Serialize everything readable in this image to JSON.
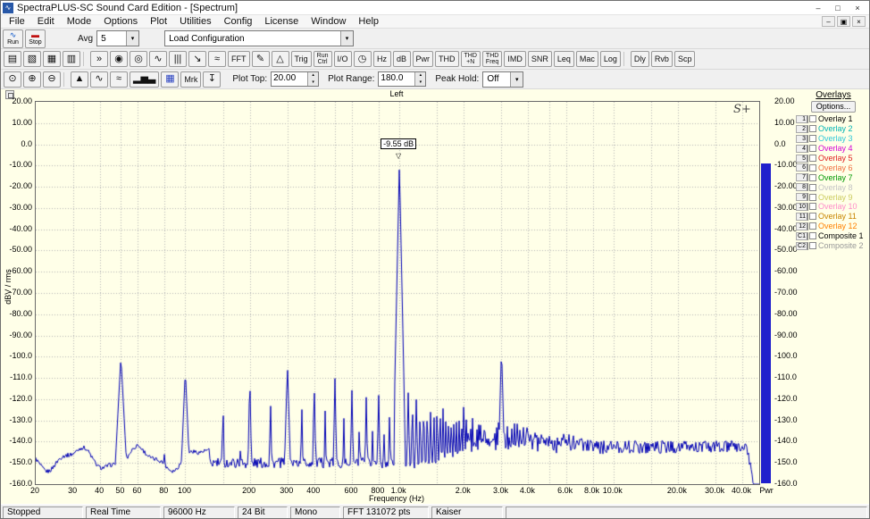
{
  "window": {
    "app_icon_glyph": "∿",
    "title": "SpectraPLUS-SC Sound Card Edition - [Spectrum]",
    "minimize": "–",
    "maximize": "□",
    "close": "×",
    "menu": [
      "File",
      "Edit",
      "Mode",
      "Options",
      "Plot",
      "Utilities",
      "Config",
      "License",
      "Window",
      "Help"
    ],
    "child_minimize": "–",
    "child_restore": "▣",
    "child_close": "×"
  },
  "transport": {
    "run_label": "Run",
    "run_icon": "∿",
    "stop_label": "Stop",
    "stop_icon": "▬",
    "avg_label": "Avg",
    "avg_value": "5",
    "config_value": "Load Configuration"
  },
  "icons": {
    "dropdown": "▾",
    "spin_up": "▴",
    "spin_down": "▾",
    "marker_down": "▽"
  },
  "toolbar2": {
    "new": "▤",
    "open": "▧",
    "save": "▦",
    "print": "▥",
    "ff": "»",
    "scope": "◉",
    "meter": "◎",
    "wave": "∿",
    "bars": "|||",
    "slope": "↘",
    "ripple": "≈",
    "fft": "FFT",
    "pencil": "✎",
    "tri": "△",
    "trig": "Trig",
    "runctrl_1": "Run",
    "runctrl_2": "Ctrl",
    "io": "I/O",
    "clock": "◷",
    "hz": "Hz",
    "db": "dB",
    "pwr": "Pwr",
    "thd": "THD",
    "thdn_1": "THD",
    "thdn_2": "+N",
    "thdf_1": "THD",
    "thdf_2": "Freq",
    "imd": "IMD",
    "snr": "SNR",
    "leq": "Leq",
    "mac": "Mac",
    "log": "Log",
    "dly": "Dly",
    "rvb": "Rvb",
    "scp": "Scp"
  },
  "toolbar3": {
    "magnifier": "⊙",
    "zoom_in": "⊕",
    "zoom_out": "⊖",
    "peak": "▲",
    "curve": "∿",
    "ripple": "≈",
    "barchart": "▂▅▃",
    "grid": "▦",
    "mrk": "Mrk",
    "flag": "↧",
    "plot_top_label": "Plot Top:",
    "plot_top_value": "20.00",
    "plot_range_label": "Plot Range:",
    "plot_range_value": "180.0",
    "peak_hold_label": "Peak Hold:",
    "peak_hold_value": "Off"
  },
  "right_meter": {
    "label": "Pwr"
  },
  "overlays": {
    "title": "Overlays",
    "options_label": "Options...",
    "items": [
      {
        "id": "1",
        "label": "Overlay 1",
        "color": "#000000"
      },
      {
        "id": "2",
        "label": "Overlay 2",
        "color": "#00b4b4"
      },
      {
        "id": "3",
        "label": "Overlay 3",
        "color": "#30c8d8"
      },
      {
        "id": "4",
        "label": "Overlay 4",
        "color": "#d400d4"
      },
      {
        "id": "5",
        "label": "Overlay 5",
        "color": "#e02020"
      },
      {
        "id": "6",
        "label": "Overlay 6",
        "color": "#f07040"
      },
      {
        "id": "7",
        "label": "Overlay 7",
        "color": "#009800"
      },
      {
        "id": "8",
        "label": "Overlay 8",
        "color": "#c4c4c4"
      },
      {
        "id": "9",
        "label": "Overlay 9",
        "color": "#cccc60"
      },
      {
        "id": "10",
        "label": "Overlay 10",
        "color": "#ff8cc8"
      },
      {
        "id": "11",
        "label": "Overlay 11",
        "color": "#c88400"
      },
      {
        "id": "12",
        "label": "Overlay 12",
        "color": "#ff8000"
      },
      {
        "id": "C1",
        "label": "Composite 1",
        "color": "#000000"
      },
      {
        "id": "C2",
        "label": "Composite 2",
        "color": "#989898"
      }
    ]
  },
  "status": [
    "Stopped",
    "Real Time",
    "96000 Hz",
    "24 Bit",
    "Mono",
    "FFT 131072 pts",
    "Kaiser"
  ],
  "chart_data": {
    "type": "line",
    "title": "Left",
    "xlabel": "Frequency (Hz)",
    "ylabel": "dBV / rms",
    "logo": "S+",
    "x_scale": "log",
    "x_range": [
      20,
      48000
    ],
    "y_range": [
      -160,
      20
    ],
    "x_ticks": [
      "20",
      "30",
      "40",
      "50",
      "60",
      "80",
      "100",
      "200",
      "300",
      "400",
      "600",
      "800",
      "1.0k",
      "2.0k",
      "3.0k",
      "4.0k",
      "6.0k",
      "8.0k",
      "10.0k",
      "20.0k",
      "30.0k",
      "40.0k"
    ],
    "x_tick_values": [
      20,
      30,
      40,
      50,
      60,
      80,
      100,
      200,
      300,
      400,
      600,
      800,
      1000,
      2000,
      3000,
      4000,
      6000,
      8000,
      10000,
      20000,
      30000,
      40000
    ],
    "grid_freqs": [
      30,
      40,
      50,
      60,
      80,
      100,
      150,
      200,
      300,
      400,
      500,
      600,
      800,
      1000,
      1500,
      2000,
      3000,
      4000,
      5000,
      6000,
      8000,
      10000,
      15000,
      20000,
      30000,
      40000
    ],
    "y_ticks": [
      "20.00",
      "10.00",
      "0.0",
      "-10.00",
      "-20.00",
      "-30.00",
      "-40.00",
      "-50.00",
      "-60.00",
      "-70.00",
      "-80.00",
      "-90.00",
      "-100.0",
      "-110.0",
      "-120.0",
      "-130.0",
      "-140.0",
      "-150.0",
      "-160.0"
    ],
    "line_color": "#0000b4",
    "plot_bg": "#ffffe8",
    "grid_color": "#b4b4b4",
    "marker": {
      "freq": 1000,
      "level": -9.55,
      "label": "-9.55 dB"
    },
    "peaks": [
      [
        25,
        -145
      ],
      [
        33,
        -143
      ],
      [
        50,
        -100,
        8
      ],
      [
        60,
        -134
      ],
      [
        80,
        -140
      ],
      [
        100,
        -106,
        10
      ],
      [
        120,
        -139
      ],
      [
        150,
        -121
      ],
      [
        180,
        -137
      ],
      [
        200,
        -108
      ],
      [
        250,
        -120
      ],
      [
        300,
        -104,
        14
      ],
      [
        350,
        -122
      ],
      [
        400,
        -112
      ],
      [
        450,
        -125
      ],
      [
        500,
        -110
      ],
      [
        550,
        -127
      ],
      [
        600,
        -115
      ],
      [
        650,
        -129
      ],
      [
        700,
        -119
      ],
      [
        750,
        -131
      ],
      [
        800,
        -116
      ],
      [
        850,
        -132
      ],
      [
        900,
        -125
      ],
      [
        950,
        -134
      ],
      [
        1000,
        -9.55,
        20
      ],
      [
        1050,
        -112
      ],
      [
        1100,
        -116
      ],
      [
        1150,
        -120
      ],
      [
        1200,
        -118
      ],
      [
        1250,
        -123
      ],
      [
        1300,
        -121
      ],
      [
        1350,
        -126
      ],
      [
        1400,
        -123
      ],
      [
        1500,
        -121
      ],
      [
        1600,
        -125
      ],
      [
        1700,
        -127
      ],
      [
        1800,
        -126
      ],
      [
        1900,
        -129
      ],
      [
        2000,
        -118
      ],
      [
        2200,
        -125
      ],
      [
        2400,
        -127
      ],
      [
        2500,
        -124
      ],
      [
        2600,
        -129
      ],
      [
        2800,
        -130
      ],
      [
        3000,
        -95,
        16
      ],
      [
        3200,
        -129
      ],
      [
        3400,
        -130
      ],
      [
        3600,
        -131
      ],
      [
        3800,
        -132
      ],
      [
        4000,
        -127
      ],
      [
        4400,
        -130
      ],
      [
        4800,
        -131
      ],
      [
        5000,
        -129
      ],
      [
        5600,
        -133
      ],
      [
        6000,
        -130
      ],
      [
        6600,
        -133
      ],
      [
        7000,
        -133
      ],
      [
        7600,
        -135
      ],
      [
        8000,
        -135
      ],
      [
        9000,
        -137
      ],
      [
        10000,
        -137
      ],
      [
        12000,
        -139
      ],
      [
        15000,
        -140
      ],
      [
        20000,
        -140
      ],
      [
        30000,
        -139
      ]
    ],
    "comb": {
      "start": 1050,
      "end": 8500,
      "step": 50,
      "level_start": -122,
      "level_end": -140
    },
    "noise_floor_db": -150,
    "hf_rolloff_hz": 42000
  }
}
